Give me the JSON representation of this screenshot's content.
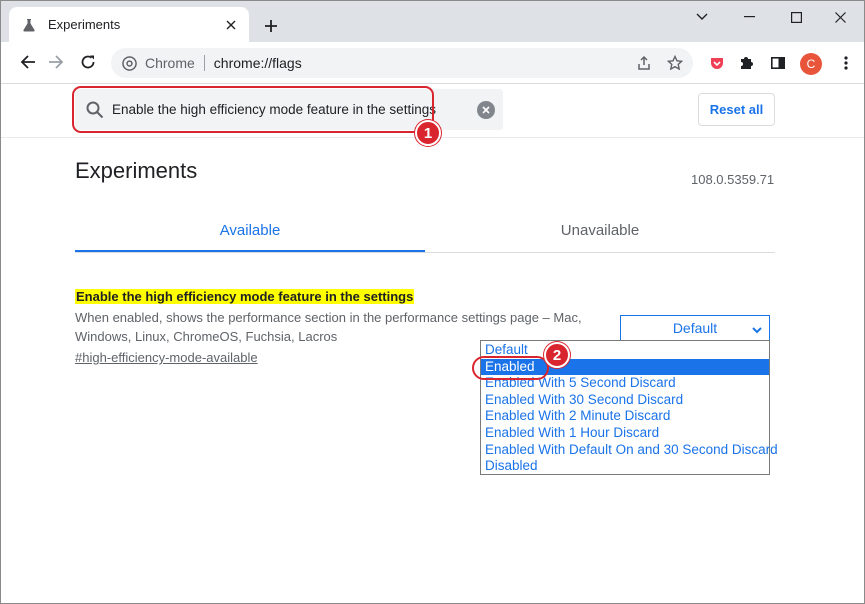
{
  "tab": {
    "title": "Experiments",
    "favicon": "flask-icon"
  },
  "omnibox": {
    "origin": "Chrome",
    "url": "chrome://flags"
  },
  "avatar": {
    "initial": "C",
    "color": "#e8553b"
  },
  "search": {
    "value": "Enable the high efficiency mode feature in the settings"
  },
  "reset_label": "Reset all",
  "page": {
    "title": "Experiments",
    "version": "108.0.5359.71"
  },
  "content_tabs": [
    {
      "label": "Available",
      "active": true
    },
    {
      "label": "Unavailable",
      "active": false
    }
  ],
  "flag": {
    "title": "Enable the high efficiency mode feature in the settings",
    "description": "When enabled, shows the performance section in the performance settings page – Mac, Windows, Linux, ChromeOS, Fuchsia, Lacros",
    "link": "#high-efficiency-mode-available",
    "selected_value": "Default",
    "options": [
      "Default",
      "Enabled",
      "Enabled With 5 Second Discard",
      "Enabled With 30 Second Discard",
      "Enabled With 2 Minute Discard",
      "Enabled With 1 Hour Discard",
      "Enabled With Default On and 30 Second Discard",
      "Disabled"
    ],
    "highlighted_option": "Enabled"
  },
  "annotations": {
    "badge1": "1",
    "badge2": "2",
    "color": "#d9262e"
  },
  "colors": {
    "accent": "#1a73e8",
    "highlight": "#ffff00",
    "tabstrip": "#dee1e6"
  }
}
